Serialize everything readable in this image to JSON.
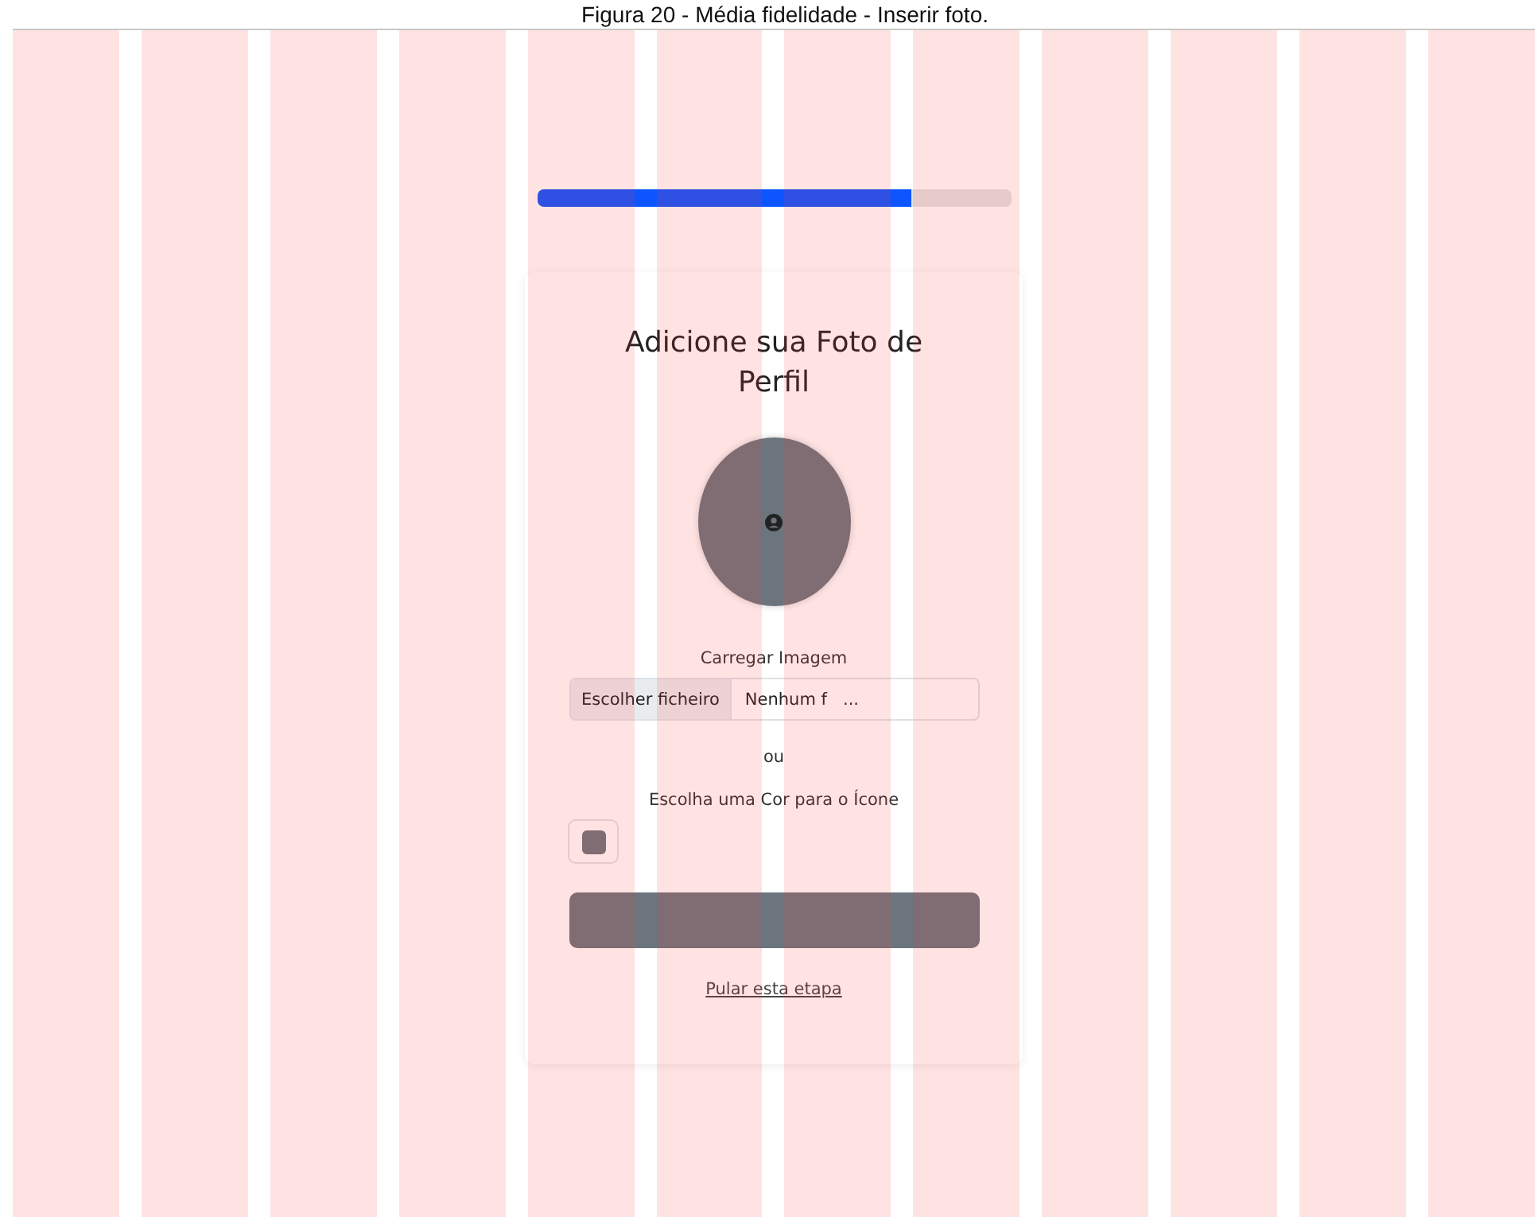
{
  "caption": "Figura 20 - Média fidelidade - Inserir foto.",
  "progress": {
    "level": 0.79
  },
  "card": {
    "title": "Adicione sua Foto de Perfil",
    "upload_label": "Carregar Imagem",
    "file_input": {
      "button": "Escolher ficheiro",
      "value": "Nenhum f   ..."
    },
    "separator": "ou",
    "color_label": "Escolha uma Cor para o Ícone",
    "skip_link": "Pular esta etapa"
  }
}
